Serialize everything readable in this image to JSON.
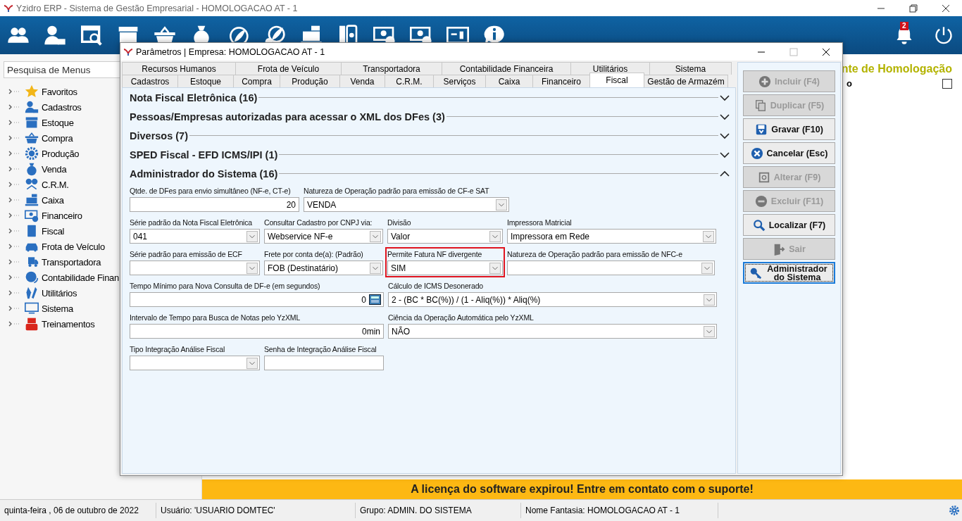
{
  "app_title": "Yzidro ERP - Sistema de Gestão Empresarial - HOMOLOGACAO AT - 1",
  "notifications": {
    "count": "2"
  },
  "sidebar": {
    "search": {
      "placeholder": "Pesquisa de Menus"
    },
    "items": [
      {
        "label": "Favoritos"
      },
      {
        "label": "Cadastros"
      },
      {
        "label": "Estoque"
      },
      {
        "label": "Compra"
      },
      {
        "label": "Produção"
      },
      {
        "label": "Venda"
      },
      {
        "label": "C.R.M."
      },
      {
        "label": "Caixa"
      },
      {
        "label": "Financeiro"
      },
      {
        "label": "Fiscal"
      },
      {
        "label": "Frota de Veículo"
      },
      {
        "label": "Transportadora"
      },
      {
        "label": "Contabilidade Finan"
      },
      {
        "label": "Utilitários"
      },
      {
        "label": "Sistema"
      },
      {
        "label": "Treinamentos"
      }
    ]
  },
  "background": {
    "heading_fragment": "nte de Homologação",
    "label_fragment": "o",
    "checkbox_checked": false
  },
  "dialog": {
    "title": "Parâmetros | Empresa: HOMOLOGACAO AT - 1",
    "tab_rows": [
      [
        {
          "label": "Recursos Humanos",
          "selected": false
        },
        {
          "label": "Frota de Veículo",
          "selected": false
        },
        {
          "label": "Transportadora",
          "selected": false
        },
        {
          "label": "Contabilidade Financeira",
          "selected": false
        },
        {
          "label": "Utilitários",
          "selected": false
        },
        {
          "label": "Sistema",
          "selected": false
        }
      ],
      [
        {
          "label": "Cadastros",
          "selected": false
        },
        {
          "label": "Estoque",
          "selected": false
        },
        {
          "label": "Compra",
          "selected": false
        },
        {
          "label": "Produção",
          "selected": false
        },
        {
          "label": "Venda",
          "selected": false
        },
        {
          "label": "C.R.M.",
          "selected": false
        },
        {
          "label": "Serviços",
          "selected": false
        },
        {
          "label": "Caixa",
          "selected": false
        },
        {
          "label": "Financeiro",
          "selected": false
        },
        {
          "label": "Fiscal",
          "selected": true
        },
        {
          "label": "Gestão de Armazém",
          "selected": false
        }
      ]
    ],
    "sections": [
      {
        "title": "Nota Fiscal Eletrônica (16)",
        "expanded": false
      },
      {
        "title": "Pessoas/Empresas autorizadas para acessar o XML dos DFes (3)",
        "expanded": false
      },
      {
        "title": "Diversos (7)",
        "expanded": false
      },
      {
        "title": "SPED Fiscal - EFD ICMS/IPI (1)",
        "expanded": false
      },
      {
        "title": "Administrador do Sistema (16)",
        "expanded": true
      }
    ],
    "form_rows": [
      [
        {
          "kind": "number",
          "label": "Qtde. de DFes para envio simultâneo (NF-e, CT-e)",
          "value": "20",
          "highlighted": false
        },
        {
          "kind": "combo",
          "label": "Natureza de Operação padrão para emissão de CF-e SAT",
          "value": "VENDA",
          "highlighted": false
        }
      ],
      [
        {
          "kind": "combo",
          "label": "Série padrão da Nota Fiscal Eletrônica",
          "value": "041",
          "highlighted": false
        },
        {
          "kind": "combo",
          "label": "Consultar Cadastro por CNPJ via:",
          "value": "Webservice NF-e",
          "highlighted": false
        },
        {
          "kind": "combo",
          "label": "Divisão",
          "value": "Valor",
          "highlighted": false
        },
        {
          "kind": "combo",
          "label": "Impressora Matricial",
          "value": "Impressora em Rede",
          "highlighted": false
        }
      ],
      [
        {
          "kind": "combo",
          "label": "Série padrão para emissão de ECF",
          "highlighted": false
        },
        {
          "kind": "combo",
          "label": "Frete por conta de(a): (Padrão)",
          "value": "FOB (Destinatário)",
          "highlighted": false
        },
        {
          "kind": "combo",
          "label": "Permite Fatura NF divergente",
          "value": "SIM",
          "highlighted": true
        },
        {
          "kind": "combo",
          "label": "Natureza de Operação padrão para emissão de NFC-e",
          "highlighted": false
        }
      ],
      [
        {
          "kind": "calc",
          "label": "Tempo Mínimo para Nova Consulta de DF-e (em segundos)",
          "value": "0",
          "highlighted": false
        },
        {
          "kind": "combo",
          "label": "Cálculo de ICMS Desonerado",
          "value": "2 - (BC * BC(%)) / (1 - Aliq(%)) * Aliq(%)",
          "highlighted": false
        }
      ],
      [
        {
          "kind": "number",
          "label": "Intervalo de Tempo para Busca de Notas pelo YzXML",
          "value": "0min",
          "highlighted": false
        },
        {
          "kind": "combo",
          "label": "Ciência da Operação Automática pelo YzXML",
          "value": "NÃO",
          "highlighted": false
        }
      ],
      [
        {
          "kind": "combo",
          "label": "Tipo Integração Análise Fiscal",
          "highlighted": false
        },
        {
          "kind": "text",
          "label": "Senha de Integração Análise Fiscal",
          "highlighted": false
        }
      ]
    ],
    "buttons": [
      {
        "label": "Incluir (F4)",
        "disabled": true,
        "focused": false
      },
      {
        "label": "Duplicar (F5)",
        "disabled": true,
        "focused": false
      },
      {
        "label": "Gravar (F10)",
        "disabled": false,
        "focused": false
      },
      {
        "label": "Cancelar (Esc)",
        "disabled": false,
        "focused": false
      },
      {
        "label": "Alterar (F9)",
        "disabled": true,
        "focused": false
      },
      {
        "label": "Excluir (F11)",
        "disabled": true,
        "focused": false
      },
      {
        "label": "Localizar (F7)",
        "disabled": false,
        "focused": false
      },
      {
        "label": "Sair",
        "disabled": true,
        "focused": false
      },
      {
        "label": "Administrador do Sistema",
        "disabled": false,
        "focused": true
      }
    ]
  },
  "banner": "A licença do software expirou! Entre em contato com o suporte!",
  "status_bar": [
    "quinta-feira , 06 de outubro de 2022",
    "Usuário: 'USUARIO DOMTEC'",
    "Grupo: ADMIN. DO SISTEMA",
    "Nome Fantasia: HOMOLOGACAO AT - 1"
  ]
}
